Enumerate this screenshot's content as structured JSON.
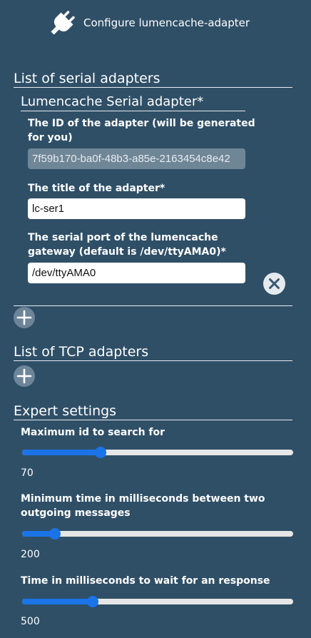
{
  "header": {
    "title": "Configure lumencache-adapter",
    "icon": "plug-icon"
  },
  "serial_section": {
    "title": "List of serial adapters",
    "adapter": {
      "title": "Lumencache Serial adapter*",
      "id_label": "The ID of the adapter (will be generated for you)",
      "id_value": "7f59b170-ba0f-48b3-a85e-2163454c8e42",
      "name_label": "The title of the adapter*",
      "name_value": "lc-ser1",
      "port_label": "The serial port of the lumencache gateway (default is /dev/ttyAMA0)*",
      "port_value": "/dev/ttyAMA0",
      "remove_icon": "close-icon"
    },
    "add_icon": "plus-icon"
  },
  "tcp_section": {
    "title": "List of TCP adapters",
    "add_icon": "plus-icon"
  },
  "expert": {
    "title": "Expert settings",
    "accent": "#1a74e8",
    "sliders": [
      {
        "label": "Maximum id to search for",
        "value": "70",
        "fraction": 0.29
      },
      {
        "label": "Minimum time in milliseconds between two outgoing messages",
        "value": "200",
        "fraction": 0.12
      },
      {
        "label": "Time in milliseconds to wait for an response",
        "value": "500",
        "fraction": 0.26
      }
    ]
  }
}
